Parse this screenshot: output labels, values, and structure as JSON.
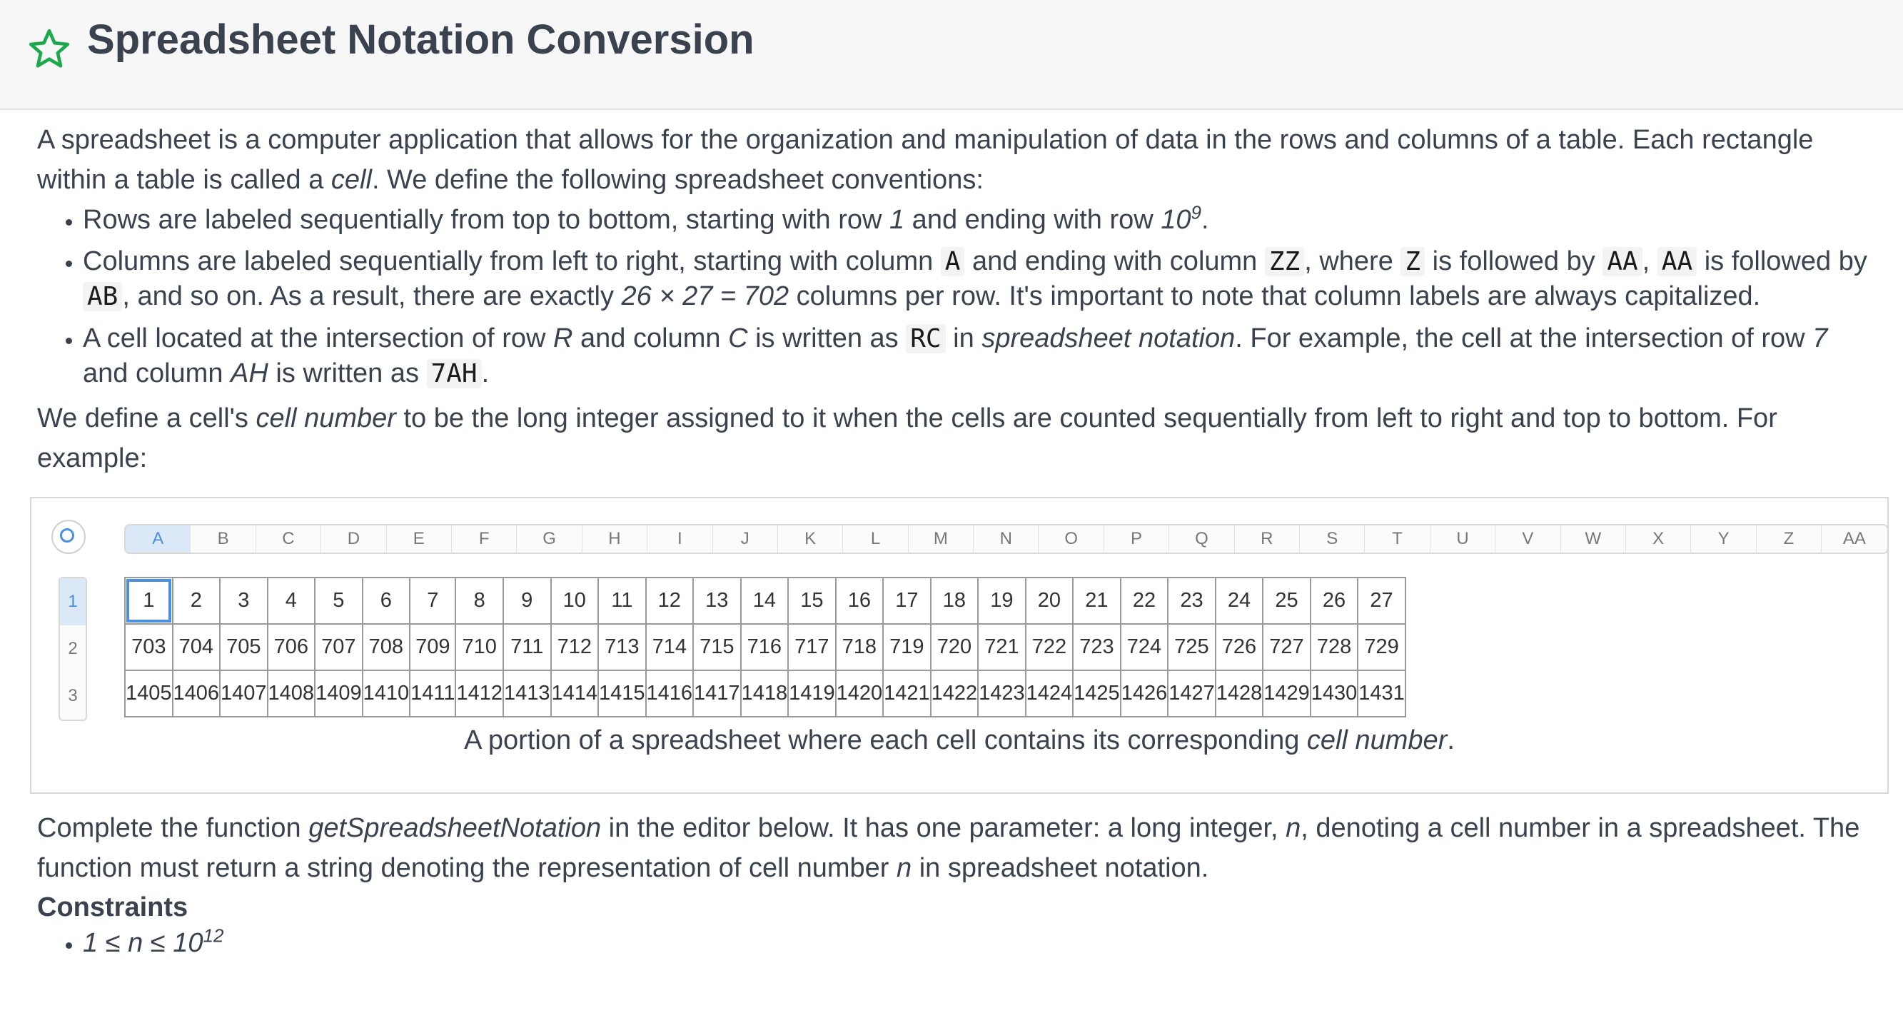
{
  "header": {
    "title": "Spreadsheet Notation Conversion"
  },
  "intro": {
    "p1_a": "A spreadsheet is a computer application that allows for the organization and manipulation of data in the rows and columns of a table. Each rectangle within a table is called a ",
    "p1_cell": "cell",
    "p1_b": ". We define the following spreadsheet conventions:"
  },
  "bullets": {
    "b1_a": "Rows are labeled sequentially from top to bottom, starting with row ",
    "b1_one": "1",
    "b1_b": " and ending with row ",
    "b1_base": "10",
    "b1_exp": "9",
    "b1_c": ".",
    "b2_a": "Columns are labeled sequentially from left to right, starting with column ",
    "b2_A": "A",
    "b2_b": " and ending with column ",
    "b2_ZZ": "ZZ",
    "b2_c": ", where ",
    "b2_Z": "Z",
    "b2_d": " is followed by ",
    "b2_AA": "AA",
    "b2_e": ", ",
    "b2_AA2": "AA",
    "b2_f": " is followed by ",
    "b2_AB": "AB",
    "b2_g": ", and so on. As a result, there are exactly ",
    "b2_math": "26 × 27 = 702",
    "b2_h": " columns per row. It's important to note that column labels are always capitalized.",
    "b3_a": "A cell located at the intersection of row ",
    "b3_R": "R",
    "b3_b": " and column ",
    "b3_C": "C",
    "b3_c": " is written as ",
    "b3_RC": "RC",
    "b3_d": " in ",
    "b3_sn": "spreadsheet notation",
    "b3_e": ". For example, the cell at the intersection of row ",
    "b3_7": "7",
    "b3_f": " and column ",
    "b3_AH": "AH",
    "b3_g": " is written as ",
    "b3_7AH": "7AH",
    "b3_h": "."
  },
  "define": {
    "a": "We define a cell's ",
    "cn": "cell number",
    "b": " to be the long integer assigned to it when the cells are counted sequentially from left to right and top to bottom. For example:"
  },
  "figure": {
    "columns": [
      "A",
      "B",
      "C",
      "D",
      "E",
      "F",
      "G",
      "H",
      "I",
      "J",
      "K",
      "L",
      "M",
      "N",
      "O",
      "P",
      "Q",
      "R",
      "S",
      "T",
      "U",
      "V",
      "W",
      "X",
      "Y",
      "Z",
      "AA"
    ],
    "row_labels": [
      "1",
      "2",
      "3"
    ],
    "rows": [
      [
        "1",
        "2",
        "3",
        "4",
        "5",
        "6",
        "7",
        "8",
        "9",
        "10",
        "11",
        "12",
        "13",
        "14",
        "15",
        "16",
        "17",
        "18",
        "19",
        "20",
        "21",
        "22",
        "23",
        "24",
        "25",
        "26",
        "27"
      ],
      [
        "703",
        "704",
        "705",
        "706",
        "707",
        "708",
        "709",
        "710",
        "711",
        "712",
        "713",
        "714",
        "715",
        "716",
        "717",
        "718",
        "719",
        "720",
        "721",
        "722",
        "723",
        "724",
        "725",
        "726",
        "727",
        "728",
        "729"
      ],
      [
        "1405",
        "1406",
        "1407",
        "1408",
        "1409",
        "1410",
        "1411",
        "1412",
        "1413",
        "1414",
        "1415",
        "1416",
        "1417",
        "1418",
        "1419",
        "1420",
        "1421",
        "1422",
        "1423",
        "1424",
        "1425",
        "1426",
        "1427",
        "1428",
        "1429",
        "1430",
        "1431"
      ]
    ],
    "caption_a": "A portion of a spreadsheet where each cell contains its corresponding ",
    "caption_cn": "cell number",
    "caption_b": "."
  },
  "task": {
    "a": "Complete the function ",
    "fn": "getSpreadsheetNotation",
    "b": " in the editor below. It has one parameter: a long integer, ",
    "n": "n",
    "c": ", denoting a cell number in a spreadsheet. The function must return a string denoting the representation of cell number ",
    "n2": "n",
    "d": " in spreadsheet notation."
  },
  "constraints": {
    "heading": "Constraints",
    "item_a": "1 ≤ n ≤ 10",
    "item_exp": "12"
  },
  "colors": {
    "accent": "#4a90e2",
    "star": "#1ba94c",
    "text": "#39424e"
  }
}
